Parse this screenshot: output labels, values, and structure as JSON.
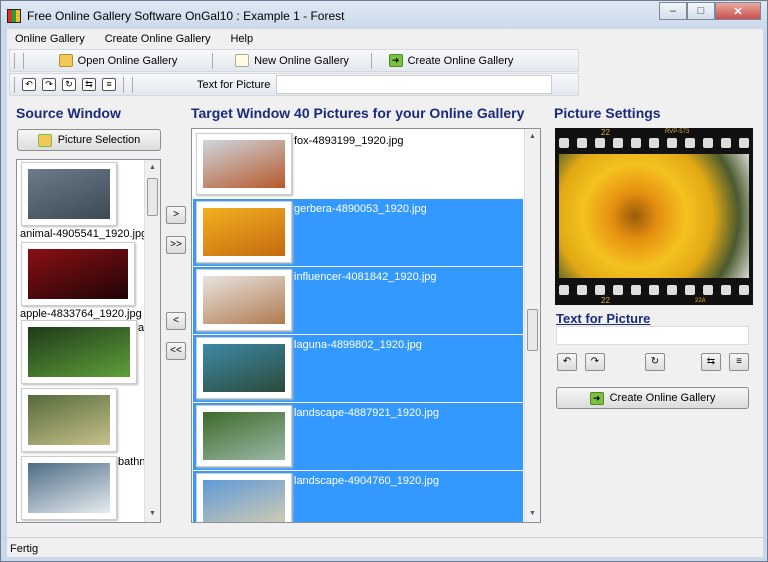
{
  "window": {
    "title": "Free Online Gallery Software OnGal10 : Example 1 - Forest",
    "minimize": "‒",
    "maximize": "□",
    "close": "✕"
  },
  "menu": [
    "Online Gallery",
    "Create Online Gallery",
    "Help"
  ],
  "toolbar": {
    "open": "Open Online Gallery",
    "new": "New Online Gallery",
    "create": "Create Online Gallery",
    "text_label": "Text for Picture",
    "text_value": "",
    "icons": [
      "rotate-left-icon",
      "rotate-right-icon",
      "rotate-180-icon",
      "flip-icon",
      "mirror-icon"
    ]
  },
  "source": {
    "heading": "Source Window",
    "selection_button": "Picture Selection",
    "items": [
      {
        "caption": "animal-4905541_1920.jpg",
        "colors": [
          "#6d7a88",
          "#3c4a55"
        ]
      },
      {
        "caption": "apple-4833764_1920.jpg",
        "colors": [
          "#8a1015",
          "#200406"
        ]
      },
      {
        "caption": "a",
        "colors": [
          "#1f3a1a",
          "#5fa03a"
        ]
      },
      {
        "caption": "",
        "colors": [
          "#556b3a",
          "#c7c08a"
        ]
      },
      {
        "caption": "bathn",
        "colors": [
          "#4e6c85",
          "#e6ecf0"
        ]
      }
    ]
  },
  "transfer": {
    "add": ">",
    "add_all": ">>",
    "remove": "<",
    "remove_all": "<<"
  },
  "target": {
    "heading": "Target Window 40 Pictures for your Online Gallery",
    "items": [
      {
        "caption": "fox-4893199_1920.jpg",
        "selected": false,
        "colors": [
          "#cfd6de",
          "#b5592a"
        ]
      },
      {
        "caption": "gerbera-4890053_1920.jpg",
        "selected": true,
        "colors": [
          "#f2b01e",
          "#c46a10"
        ]
      },
      {
        "caption": "influencer-4081842_1920.jpg",
        "selected": true,
        "colors": [
          "#e8e4df",
          "#b07a50"
        ]
      },
      {
        "caption": "laguna-4899802_1920.jpg",
        "selected": true,
        "colors": [
          "#3d8aa8",
          "#2c4a3a"
        ]
      },
      {
        "caption": "landscape-4887921_1920.jpg",
        "selected": true,
        "colors": [
          "#3f6a2a",
          "#9bb8a8"
        ]
      },
      {
        "caption": "landscape-4904760_1920.jpg",
        "selected": true,
        "colors": [
          "#5d9ad8",
          "#d8cdb0"
        ]
      }
    ]
  },
  "settings": {
    "heading": "Picture Settings",
    "film_marks": [
      "22",
      "RVP-573",
      "22",
      "22A"
    ],
    "text_heading": "Text for Picture",
    "text_value": "",
    "create": "Create Online Gallery"
  },
  "status": "Fertig"
}
